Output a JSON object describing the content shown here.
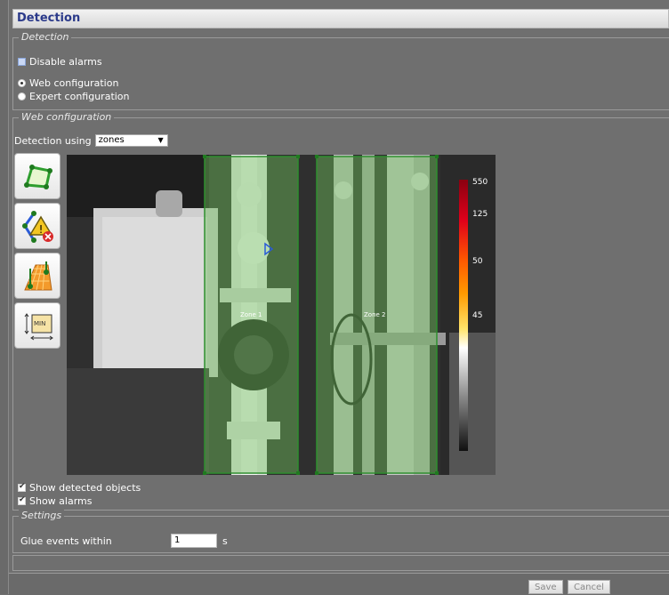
{
  "title": "Detection",
  "detection_section": {
    "legend": "Detection",
    "disable_alarms": {
      "label": "Disable alarms",
      "checked": false
    },
    "radios": [
      {
        "label": "Web configuration",
        "selected": true
      },
      {
        "label": "Expert configuration",
        "selected": false
      }
    ]
  },
  "web_config": {
    "legend": "Web configuration",
    "detection_using_label": "Detection using",
    "detection_using_value": "zones",
    "tools": [
      "polygon-zone-icon",
      "line-alarm-icon",
      "perspective-grid-icon",
      "min-size-icon"
    ],
    "min_label": "MIN",
    "zones": [
      "Zone 1",
      "Zone 2"
    ],
    "scale_labels": [
      "550",
      "125",
      "50",
      "45"
    ],
    "show_detected_objects": {
      "label": "Show detected objects",
      "checked": true
    },
    "show_alarms": {
      "label": "Show alarms",
      "checked": true
    }
  },
  "settings": {
    "legend": "Settings",
    "glue_label": "Glue events within",
    "glue_value": "1",
    "glue_unit": "s"
  },
  "buttons": {
    "save": "Save",
    "cancel": "Cancel"
  },
  "colors": {
    "title_text": "#2b3a8a",
    "zone_fill": "#6fbf5a",
    "zone_border": "#2f8f2f"
  }
}
